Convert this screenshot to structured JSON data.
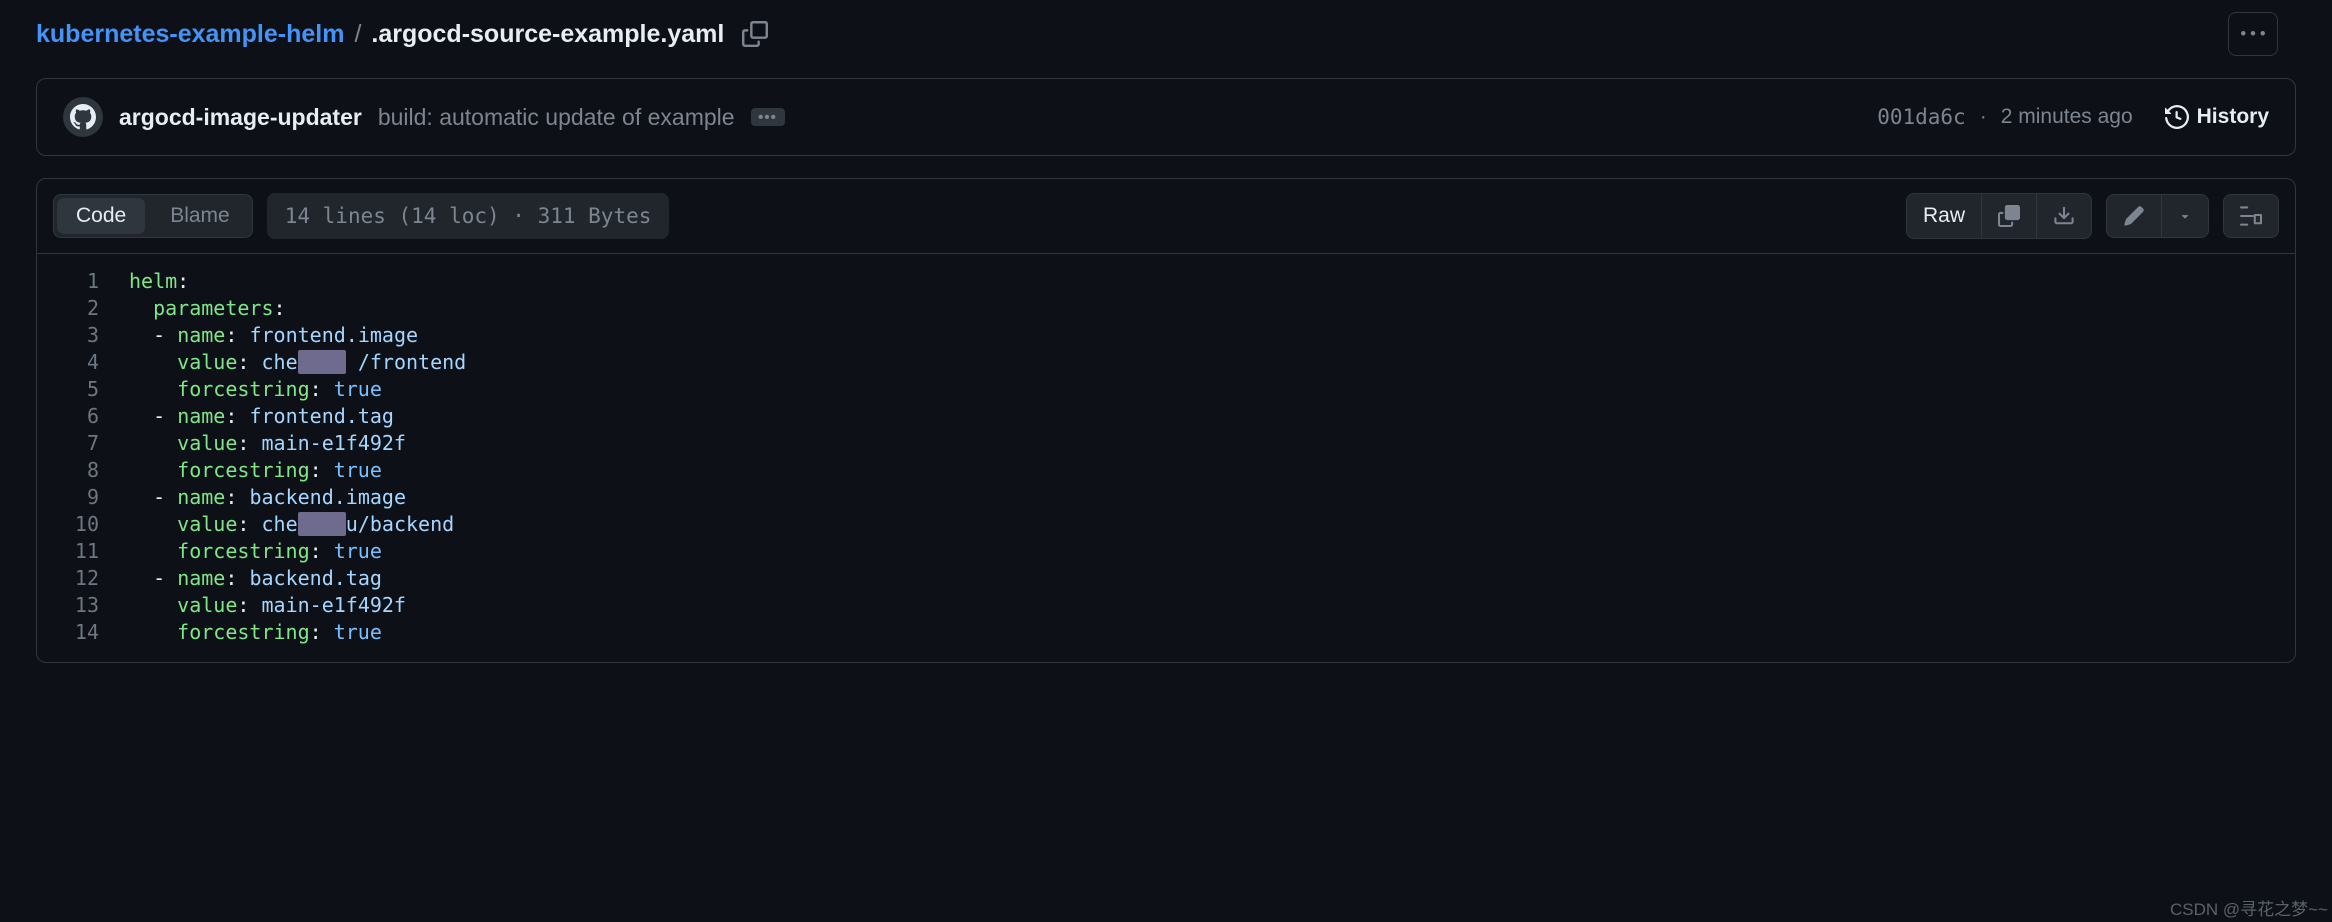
{
  "breadcrumb": {
    "repo": "kubernetes-example-helm",
    "sep": "/",
    "file": ".argocd-source-example.yaml"
  },
  "commit": {
    "author": "argocd-image-updater",
    "message": "build: automatic update of example",
    "sha": "001da6c",
    "dot": "·",
    "time": "2 minutes ago",
    "history_label": "History"
  },
  "tabs": {
    "code": "Code",
    "blame": "Blame"
  },
  "file_meta": "14 lines (14 loc) · 311 Bytes",
  "actions": {
    "raw": "Raw"
  },
  "code_lines": [
    {
      "n": "1",
      "indent": "",
      "dash": "",
      "key": "helm",
      "colon": ":",
      "val": "",
      "valclass": ""
    },
    {
      "n": "2",
      "indent": "  ",
      "dash": "",
      "key": "parameters",
      "colon": ":",
      "val": "",
      "valclass": ""
    },
    {
      "n": "3",
      "indent": "  ",
      "dash": "- ",
      "key": "name",
      "colon": ": ",
      "val": "frontend.image",
      "valclass": "tok-str"
    },
    {
      "n": "4",
      "indent": "    ",
      "dash": "",
      "key": "value",
      "colon": ": ",
      "pre": "che",
      "red": "████",
      "post": " /frontend",
      "valclass": "tok-str"
    },
    {
      "n": "5",
      "indent": "    ",
      "dash": "",
      "key": "forcestring",
      "colon": ": ",
      "val": "true",
      "valclass": "tok-bool"
    },
    {
      "n": "6",
      "indent": "  ",
      "dash": "- ",
      "key": "name",
      "colon": ": ",
      "val": "frontend.tag",
      "valclass": "tok-str"
    },
    {
      "n": "7",
      "indent": "    ",
      "dash": "",
      "key": "value",
      "colon": ": ",
      "val": "main-e1f492f",
      "valclass": "tok-str"
    },
    {
      "n": "8",
      "indent": "    ",
      "dash": "",
      "key": "forcestring",
      "colon": ": ",
      "val": "true",
      "valclass": "tok-bool"
    },
    {
      "n": "9",
      "indent": "  ",
      "dash": "- ",
      "key": "name",
      "colon": ": ",
      "val": "backend.image",
      "valclass": "tok-str"
    },
    {
      "n": "10",
      "indent": "    ",
      "dash": "",
      "key": "value",
      "colon": ": ",
      "pre": "che",
      "red": "████",
      "post": "u/backend",
      "valclass": "tok-str"
    },
    {
      "n": "11",
      "indent": "    ",
      "dash": "",
      "key": "forcestring",
      "colon": ": ",
      "val": "true",
      "valclass": "tok-bool"
    },
    {
      "n": "12",
      "indent": "  ",
      "dash": "- ",
      "key": "name",
      "colon": ": ",
      "val": "backend.tag",
      "valclass": "tok-str"
    },
    {
      "n": "13",
      "indent": "    ",
      "dash": "",
      "key": "value",
      "colon": ": ",
      "val": "main-e1f492f",
      "valclass": "tok-str"
    },
    {
      "n": "14",
      "indent": "    ",
      "dash": "",
      "key": "forcestring",
      "colon": ": ",
      "val": "true",
      "valclass": "tok-bool"
    }
  ],
  "watermark": "CSDN @寻花之梦~~"
}
